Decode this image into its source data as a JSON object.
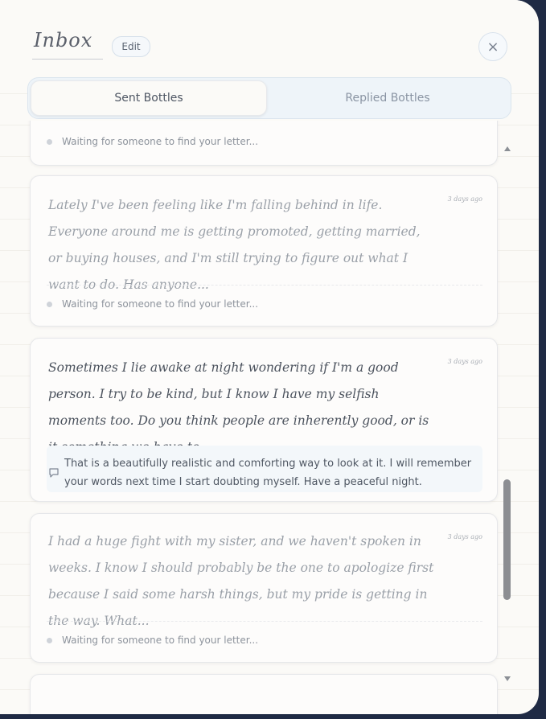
{
  "header": {
    "title": "Inbox",
    "edit_label": "Edit",
    "close_icon": "×"
  },
  "tabs": [
    {
      "label": "Sent Bottles",
      "active": true
    },
    {
      "label": "Replied Bottles",
      "active": false
    }
  ],
  "cards": [
    {
      "status": "Waiting for someone to find your letter..."
    },
    {
      "text": "Lately I've been feeling like I'm falling behind in life. Everyone around me is getting promoted, getting married, or buying houses, and I'm still trying to figure out what I want to do. Has anyone...",
      "time": "3 days ago",
      "status": "Waiting for someone to find your letter..."
    },
    {
      "text": "Sometimes I lie awake at night wondering if I'm a good person. I try to be kind, but I know I have my selfish moments too. Do you think people are inherently good, or is it something we have to...",
      "time": "3 days ago",
      "reply": "That is a beautifully realistic and comforting way to look at it. I will remember your words next time I start doubting myself. Have a peaceful night."
    },
    {
      "text": "I had a huge fight with my sister, and we haven't spoken in weeks. I know I should probably be the one to apologize first because I said some harsh things, but my pride is getting in the way. What...",
      "time": "3 days ago",
      "status": "Waiting for someone to find your letter..."
    }
  ],
  "icons": {
    "close": "close-icon",
    "reply": "speech-bubble-icon",
    "scroll_up": "scroll-up-arrow-icon",
    "scroll_down": "scroll-down-arrow-icon"
  }
}
